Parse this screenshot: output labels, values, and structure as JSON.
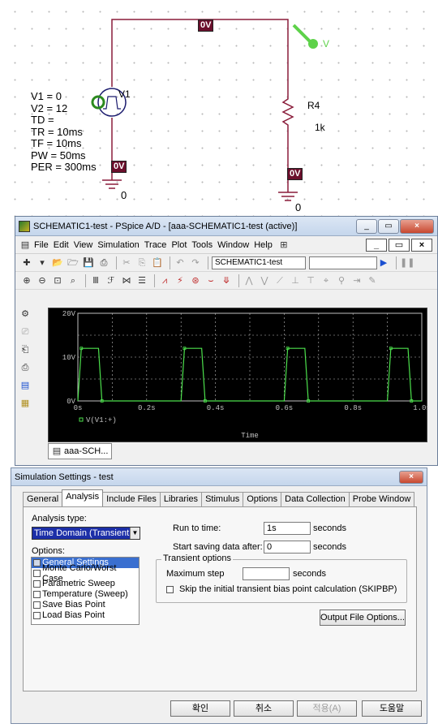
{
  "schematic": {
    "net_top_voltage": "0V",
    "source_node_voltage": "0V",
    "resistor_node_voltage": "0V",
    "probe_label": "V",
    "source_name": "V1",
    "source_params": [
      "V1 = 0",
      "V2 = 12",
      "TD =",
      "TR = 10ms",
      "TF = 10ms",
      "PW = 50ms",
      "PER = 300ms"
    ],
    "resistor_name": "R4",
    "resistor_value": "1k",
    "ground_left": "0",
    "ground_right": "0",
    "colors": {
      "wire": "#8a1c3a",
      "marker": "#6b0f2c",
      "probe": "#5ed24a"
    }
  },
  "pspice": {
    "title": "SCHEMATIC1-test - PSpice A/D  - [aaa-SCHEMATIC1-test (active)]",
    "menu": [
      "File",
      "Edit",
      "View",
      "Simulation",
      "Trace",
      "Plot",
      "Tools",
      "Window",
      "Help"
    ],
    "profile_combo": "SCHEMATIC1-test",
    "doc_tab": "aaa-SCH...",
    "win_buttons": {
      "min": "_",
      "max": "▭",
      "close": "×"
    }
  },
  "chart_data": {
    "type": "line",
    "xlabel": "Time",
    "x_ticks": [
      "0s",
      "0.2s",
      "0.4s",
      "0.6s",
      "0.8s",
      "1.0s"
    ],
    "y_ticks": [
      "0V",
      "10V",
      "20V"
    ],
    "xlim": [
      0,
      1.0
    ],
    "ylim": [
      0,
      20
    ],
    "grid": true,
    "legend": "bottom-left",
    "series": [
      {
        "name": "V(V1:+)",
        "color": "#4ce04c",
        "x": [
          0,
          0.01,
          0.06,
          0.07,
          0.3,
          0.31,
          0.36,
          0.37,
          0.6,
          0.61,
          0.66,
          0.67,
          0.9,
          0.91,
          0.96,
          0.97,
          1.0
        ],
        "y": [
          0,
          12,
          12,
          0,
          0,
          12,
          12,
          0,
          0,
          12,
          12,
          0,
          0,
          12,
          12,
          0,
          0
        ]
      }
    ]
  },
  "dialog": {
    "title": "Simulation Settings - test",
    "close": "×",
    "tabs": [
      "General",
      "Analysis",
      "Include Files",
      "Libraries",
      "Stimulus",
      "Options",
      "Data Collection",
      "Probe Window"
    ],
    "active_tab": "Analysis",
    "analysis_type_label": "Analysis type:",
    "analysis_type_value": "Time Domain (Transient",
    "options_label": "Options:",
    "options": [
      {
        "label": "General Settings",
        "checked": true
      },
      {
        "label": "Monte Carlo/Worst Case",
        "checked": false
      },
      {
        "label": "Parametric Sweep",
        "checked": false
      },
      {
        "label": "Temperature (Sweep)",
        "checked": false
      },
      {
        "label": "Save Bias Point",
        "checked": false
      },
      {
        "label": "Load Bias Point",
        "checked": false
      }
    ],
    "run_to_time_label": "Run to time:",
    "run_to_time_value": "1s",
    "run_to_time_unit": "seconds",
    "start_saving_label": "Start saving data after:",
    "start_saving_value": "0",
    "start_saving_unit": "seconds",
    "transient_group": "Transient options",
    "max_step_label": "Maximum step",
    "max_step_value": "",
    "max_step_unit": "seconds",
    "skip_bias_label": "Skip the initial transient bias point calculation  (SKIPBP)",
    "output_file_button": "Output File Options...",
    "ok_button": "확인",
    "cancel_button": "취소",
    "apply_button": "적용(A)",
    "help_button": "도움말"
  }
}
